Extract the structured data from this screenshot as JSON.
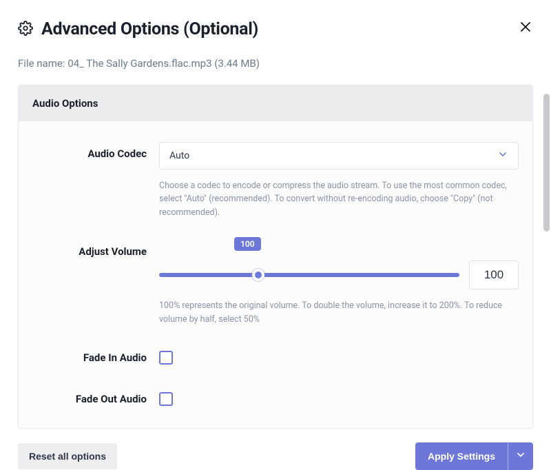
{
  "header": {
    "title": "Advanced Options (Optional)"
  },
  "file": {
    "prefix": "File name:",
    "name": "04_ The Sally Gardens.flac.mp3 (3.44 MB)"
  },
  "panel": {
    "title": "Audio Options",
    "codec": {
      "label": "Audio Codec",
      "value": "Auto",
      "help": "Choose a codec to encode or compress the audio stream. To use the most common codec, select \"Auto\" (recommended). To convert without re-encoding audio, choose \"Copy\" (not recommended)."
    },
    "volume": {
      "label": "Adjust Volume",
      "badge": "100",
      "value": "100",
      "help": "100% represents the original volume. To double the volume, increase it to 200%. To reduce volume by half, select 50%"
    },
    "fade_in": {
      "label": "Fade In Audio"
    },
    "fade_out": {
      "label": "Fade Out Audio"
    }
  },
  "footer": {
    "reset": "Reset all options",
    "apply": "Apply Settings"
  },
  "colors": {
    "accent": "#6d77d8",
    "text_primary": "#1a202c",
    "text_muted": "#8a94a6"
  }
}
